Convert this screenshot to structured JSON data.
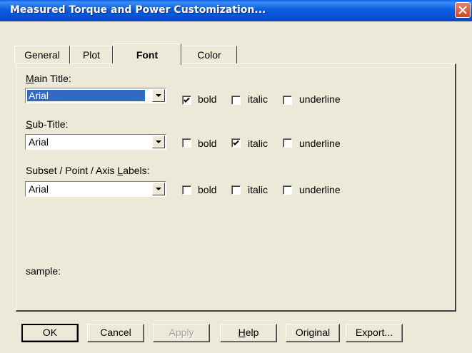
{
  "window": {
    "title": "Measured Torque and Power Customization..."
  },
  "tabs": [
    {
      "label": "General"
    },
    {
      "label": "Plot"
    },
    {
      "label": "Font",
      "active": true
    },
    {
      "label": "Color"
    }
  ],
  "font_settings": {
    "main_title": {
      "label_mnemonic": "M",
      "label_rest": "ain Title:",
      "font": "Arial",
      "bold": true,
      "italic": false,
      "underline": false
    },
    "sub_title": {
      "label_mnemonic": "S",
      "label_rest": "ub-Title:",
      "font": "Arial",
      "bold": false,
      "italic": true,
      "underline": false
    },
    "labels": {
      "label_prefix": "Subset / Point / Axis ",
      "label_mnemonic": "L",
      "label_rest": "abels:",
      "font": "Arial",
      "bold": false,
      "italic": false,
      "underline": false
    }
  },
  "option_labels": {
    "bold": "bold",
    "italic": "italic",
    "underline": "underline"
  },
  "sample_label": "sample:",
  "buttons": {
    "ok": "OK",
    "cancel": "Cancel",
    "apply": "Apply",
    "help_mnemonic": "H",
    "help_rest": "elp",
    "original": "Original",
    "export": "Export..."
  }
}
